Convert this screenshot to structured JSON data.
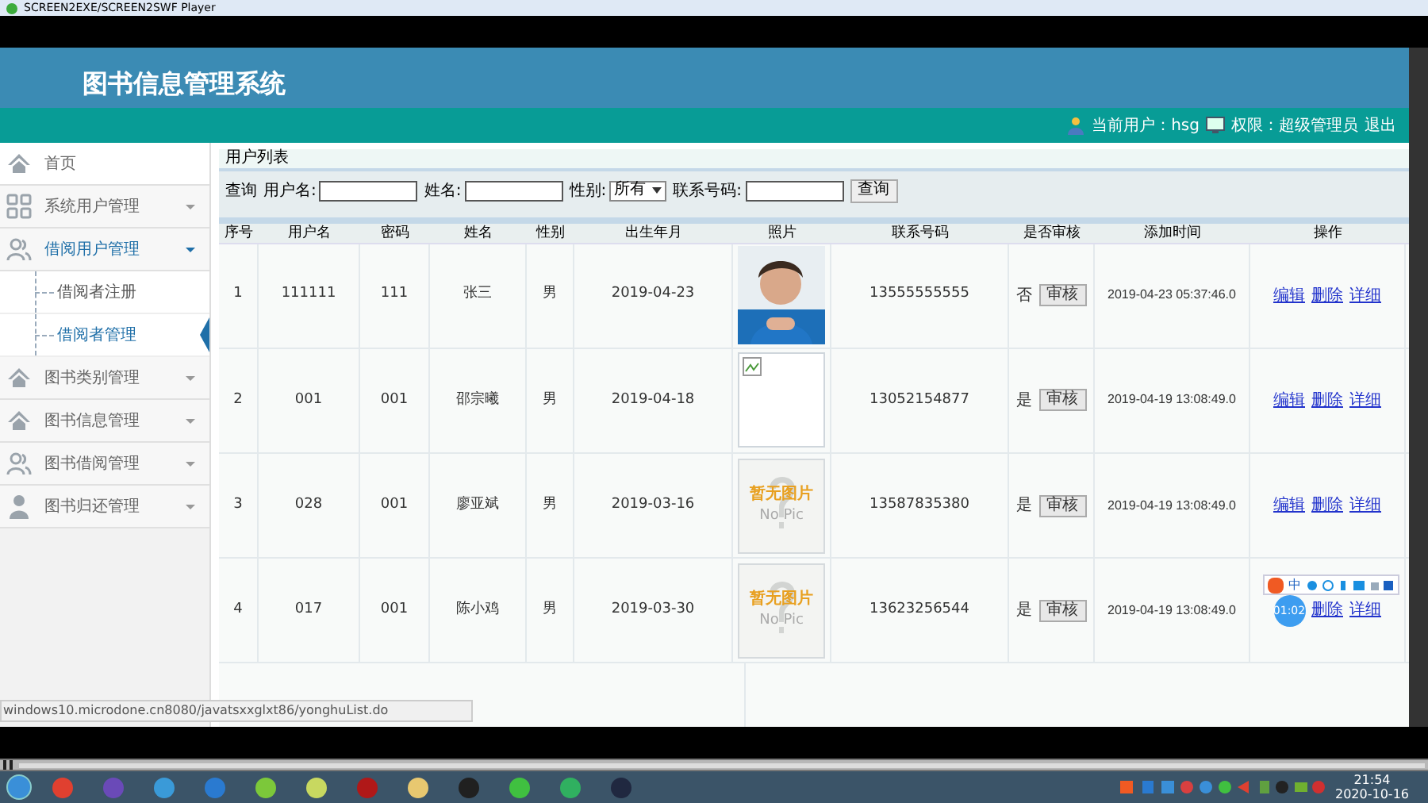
{
  "window": {
    "title": "SCREEN2EXE/SCREEN2SWF Player"
  },
  "header": {
    "app_title": "图书信息管理系统",
    "current_user": "当前用户：hsg",
    "role": "权限：超级管理员",
    "logout": "退出"
  },
  "sidebar": {
    "items": [
      {
        "label": "首页",
        "kind": "home",
        "expanded": false
      },
      {
        "label": "系统用户管理",
        "kind": "system",
        "expanded": false
      },
      {
        "label": "借阅用户管理",
        "kind": "readers",
        "expanded": true,
        "children": [
          {
            "label": "借阅者注册",
            "selected": false
          },
          {
            "label": "借阅者管理",
            "selected": true
          }
        ]
      },
      {
        "label": "图书类别管理",
        "kind": "category",
        "expanded": false
      },
      {
        "label": "图书信息管理",
        "kind": "info",
        "expanded": false
      },
      {
        "label": "图书借阅管理",
        "kind": "borrow",
        "expanded": false
      },
      {
        "label": "图书归还管理",
        "kind": "return",
        "expanded": false
      }
    ]
  },
  "panel": {
    "title": "用户列表"
  },
  "search": {
    "label": "查询",
    "fields": [
      {
        "label": "用户名:",
        "kind": "text"
      },
      {
        "label": "姓名:",
        "kind": "text"
      },
      {
        "label": "性别:",
        "kind": "select",
        "value": "所有"
      },
      {
        "label": "联系号码:",
        "kind": "text"
      }
    ],
    "button": "查询"
  },
  "table": {
    "columns": [
      "序号",
      "用户名",
      "密码",
      "姓名",
      "性别",
      "出生年月",
      "照片",
      "联系号码",
      "是否审核",
      "添加时间",
      "操作"
    ],
    "rows": [
      {
        "cells": [
          "1",
          "111111",
          "111",
          "张三",
          "男",
          "2019-04-23"
        ],
        "photo": {
          "kind": "picture"
        },
        "phone": "13555555555",
        "approved": "否",
        "approve_button": "审核",
        "added": "2019-04-23 05:37:46.0",
        "actions": [
          "编辑",
          "删除",
          "详细"
        ]
      },
      {
        "cells": [
          "2",
          "001",
          "001",
          "邵宗曦",
          "男",
          "2019-04-18"
        ],
        "photo": {
          "kind": "broken"
        },
        "phone": "13052154877",
        "approved": "是",
        "approve_button": "审核",
        "added": "2019-04-19 13:08:49.0",
        "actions": [
          "编辑",
          "删除",
          "详细"
        ]
      },
      {
        "cells": [
          "3",
          "028",
          "001",
          "廖亚斌",
          "男",
          "2019-03-16"
        ],
        "photo": {
          "kind": "no_pic",
          "text": "暂无图片",
          "subtext": "No Pic"
        },
        "phone": "13587835380",
        "approved": "是",
        "approve_button": "审核",
        "added": "2019-04-19 13:08:49.0",
        "actions": [
          "编辑",
          "删除",
          "详细"
        ]
      },
      {
        "cells": [
          "4",
          "017",
          "001",
          "陈小鸡",
          "男",
          "2019-03-30"
        ],
        "photo": {
          "kind": "no_pic",
          "text": "暂无图片",
          "subtext": "No Pic"
        },
        "phone": "13623256544",
        "approved": "是",
        "approve_button": "审核",
        "added": "2019-04-19 13:08:49.0",
        "timer_badge": "01:02",
        "actions": [
          "删除",
          "详细"
        ]
      }
    ]
  },
  "status_url": "windows10.microdone.cn8080/javatsxxglxt86/yonghuList.do",
  "ime_toolbar": {
    "mode": "中"
  },
  "taskbar": {
    "time": "21:54",
    "date": "2020-10-16"
  }
}
